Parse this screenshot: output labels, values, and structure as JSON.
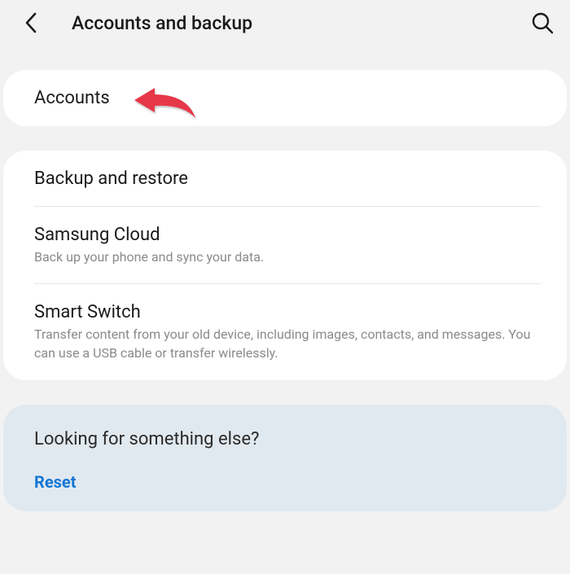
{
  "header": {
    "title": "Accounts and backup"
  },
  "section1": {
    "item0": {
      "title": "Accounts"
    }
  },
  "section2": {
    "item0": {
      "title": "Backup and restore"
    },
    "item1": {
      "title": "Samsung Cloud",
      "desc": "Back up your phone and sync your data."
    },
    "item2": {
      "title": "Smart Switch",
      "desc": "Transfer content from your old device, including images, contacts, and messages. You can use a USB cable or transfer wirelessly."
    }
  },
  "bottom": {
    "title": "Looking for something else?",
    "link": "Reset"
  }
}
